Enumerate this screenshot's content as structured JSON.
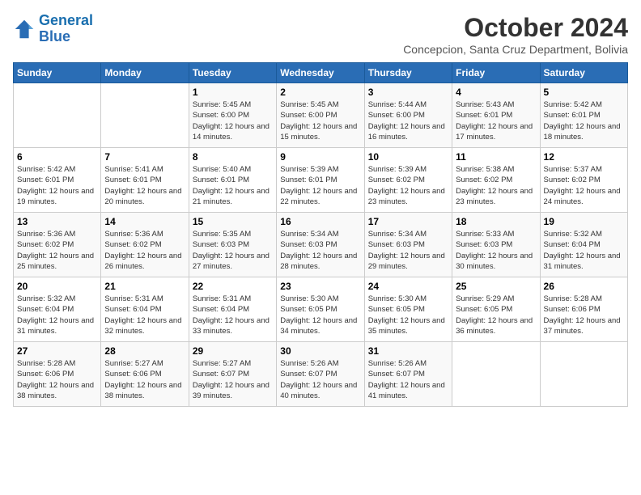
{
  "logo": {
    "text_general": "General",
    "text_blue": "Blue"
  },
  "header": {
    "month": "October 2024",
    "location": "Concepcion, Santa Cruz Department, Bolivia"
  },
  "weekdays": [
    "Sunday",
    "Monday",
    "Tuesday",
    "Wednesday",
    "Thursday",
    "Friday",
    "Saturday"
  ],
  "weeks": [
    [
      {
        "day": "",
        "sunrise": "",
        "sunset": "",
        "daylight": ""
      },
      {
        "day": "",
        "sunrise": "",
        "sunset": "",
        "daylight": ""
      },
      {
        "day": "1",
        "sunrise": "Sunrise: 5:45 AM",
        "sunset": "Sunset: 6:00 PM",
        "daylight": "Daylight: 12 hours and 14 minutes."
      },
      {
        "day": "2",
        "sunrise": "Sunrise: 5:45 AM",
        "sunset": "Sunset: 6:00 PM",
        "daylight": "Daylight: 12 hours and 15 minutes."
      },
      {
        "day": "3",
        "sunrise": "Sunrise: 5:44 AM",
        "sunset": "Sunset: 6:00 PM",
        "daylight": "Daylight: 12 hours and 16 minutes."
      },
      {
        "day": "4",
        "sunrise": "Sunrise: 5:43 AM",
        "sunset": "Sunset: 6:01 PM",
        "daylight": "Daylight: 12 hours and 17 minutes."
      },
      {
        "day": "5",
        "sunrise": "Sunrise: 5:42 AM",
        "sunset": "Sunset: 6:01 PM",
        "daylight": "Daylight: 12 hours and 18 minutes."
      }
    ],
    [
      {
        "day": "6",
        "sunrise": "Sunrise: 5:42 AM",
        "sunset": "Sunset: 6:01 PM",
        "daylight": "Daylight: 12 hours and 19 minutes."
      },
      {
        "day": "7",
        "sunrise": "Sunrise: 5:41 AM",
        "sunset": "Sunset: 6:01 PM",
        "daylight": "Daylight: 12 hours and 20 minutes."
      },
      {
        "day": "8",
        "sunrise": "Sunrise: 5:40 AM",
        "sunset": "Sunset: 6:01 PM",
        "daylight": "Daylight: 12 hours and 21 minutes."
      },
      {
        "day": "9",
        "sunrise": "Sunrise: 5:39 AM",
        "sunset": "Sunset: 6:01 PM",
        "daylight": "Daylight: 12 hours and 22 minutes."
      },
      {
        "day": "10",
        "sunrise": "Sunrise: 5:39 AM",
        "sunset": "Sunset: 6:02 PM",
        "daylight": "Daylight: 12 hours and 23 minutes."
      },
      {
        "day": "11",
        "sunrise": "Sunrise: 5:38 AM",
        "sunset": "Sunset: 6:02 PM",
        "daylight": "Daylight: 12 hours and 23 minutes."
      },
      {
        "day": "12",
        "sunrise": "Sunrise: 5:37 AM",
        "sunset": "Sunset: 6:02 PM",
        "daylight": "Daylight: 12 hours and 24 minutes."
      }
    ],
    [
      {
        "day": "13",
        "sunrise": "Sunrise: 5:36 AM",
        "sunset": "Sunset: 6:02 PM",
        "daylight": "Daylight: 12 hours and 25 minutes."
      },
      {
        "day": "14",
        "sunrise": "Sunrise: 5:36 AM",
        "sunset": "Sunset: 6:02 PM",
        "daylight": "Daylight: 12 hours and 26 minutes."
      },
      {
        "day": "15",
        "sunrise": "Sunrise: 5:35 AM",
        "sunset": "Sunset: 6:03 PM",
        "daylight": "Daylight: 12 hours and 27 minutes."
      },
      {
        "day": "16",
        "sunrise": "Sunrise: 5:34 AM",
        "sunset": "Sunset: 6:03 PM",
        "daylight": "Daylight: 12 hours and 28 minutes."
      },
      {
        "day": "17",
        "sunrise": "Sunrise: 5:34 AM",
        "sunset": "Sunset: 6:03 PM",
        "daylight": "Daylight: 12 hours and 29 minutes."
      },
      {
        "day": "18",
        "sunrise": "Sunrise: 5:33 AM",
        "sunset": "Sunset: 6:03 PM",
        "daylight": "Daylight: 12 hours and 30 minutes."
      },
      {
        "day": "19",
        "sunrise": "Sunrise: 5:32 AM",
        "sunset": "Sunset: 6:04 PM",
        "daylight": "Daylight: 12 hours and 31 minutes."
      }
    ],
    [
      {
        "day": "20",
        "sunrise": "Sunrise: 5:32 AM",
        "sunset": "Sunset: 6:04 PM",
        "daylight": "Daylight: 12 hours and 31 minutes."
      },
      {
        "day": "21",
        "sunrise": "Sunrise: 5:31 AM",
        "sunset": "Sunset: 6:04 PM",
        "daylight": "Daylight: 12 hours and 32 minutes."
      },
      {
        "day": "22",
        "sunrise": "Sunrise: 5:31 AM",
        "sunset": "Sunset: 6:04 PM",
        "daylight": "Daylight: 12 hours and 33 minutes."
      },
      {
        "day": "23",
        "sunrise": "Sunrise: 5:30 AM",
        "sunset": "Sunset: 6:05 PM",
        "daylight": "Daylight: 12 hours and 34 minutes."
      },
      {
        "day": "24",
        "sunrise": "Sunrise: 5:30 AM",
        "sunset": "Sunset: 6:05 PM",
        "daylight": "Daylight: 12 hours and 35 minutes."
      },
      {
        "day": "25",
        "sunrise": "Sunrise: 5:29 AM",
        "sunset": "Sunset: 6:05 PM",
        "daylight": "Daylight: 12 hours and 36 minutes."
      },
      {
        "day": "26",
        "sunrise": "Sunrise: 5:28 AM",
        "sunset": "Sunset: 6:06 PM",
        "daylight": "Daylight: 12 hours and 37 minutes."
      }
    ],
    [
      {
        "day": "27",
        "sunrise": "Sunrise: 5:28 AM",
        "sunset": "Sunset: 6:06 PM",
        "daylight": "Daylight: 12 hours and 38 minutes."
      },
      {
        "day": "28",
        "sunrise": "Sunrise: 5:27 AM",
        "sunset": "Sunset: 6:06 PM",
        "daylight": "Daylight: 12 hours and 38 minutes."
      },
      {
        "day": "29",
        "sunrise": "Sunrise: 5:27 AM",
        "sunset": "Sunset: 6:07 PM",
        "daylight": "Daylight: 12 hours and 39 minutes."
      },
      {
        "day": "30",
        "sunrise": "Sunrise: 5:26 AM",
        "sunset": "Sunset: 6:07 PM",
        "daylight": "Daylight: 12 hours and 40 minutes."
      },
      {
        "day": "31",
        "sunrise": "Sunrise: 5:26 AM",
        "sunset": "Sunset: 6:07 PM",
        "daylight": "Daylight: 12 hours and 41 minutes."
      },
      {
        "day": "",
        "sunrise": "",
        "sunset": "",
        "daylight": ""
      },
      {
        "day": "",
        "sunrise": "",
        "sunset": "",
        "daylight": ""
      }
    ]
  ]
}
